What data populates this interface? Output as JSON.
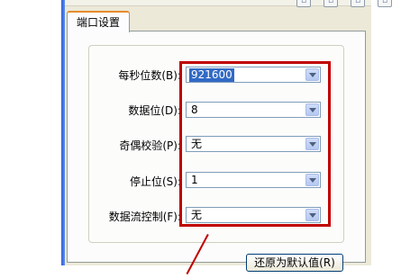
{
  "tab": {
    "label": "端口设置"
  },
  "fields": [
    {
      "label": "每秒位数(B):",
      "value": "921600",
      "selected": true
    },
    {
      "label": "数据位(D):",
      "value": "8"
    },
    {
      "label": "奇偶校验(P):",
      "value": "无"
    },
    {
      "label": "停止位(S):",
      "value": "1"
    },
    {
      "label": "数据流控制(F):",
      "value": "无"
    }
  ],
  "buttons": {
    "restore_defaults": "还原为默认值(R)"
  },
  "colors": {
    "highlight": "#c00000",
    "tab_accent": "#e68b2c",
    "selection": "#316ac5"
  }
}
